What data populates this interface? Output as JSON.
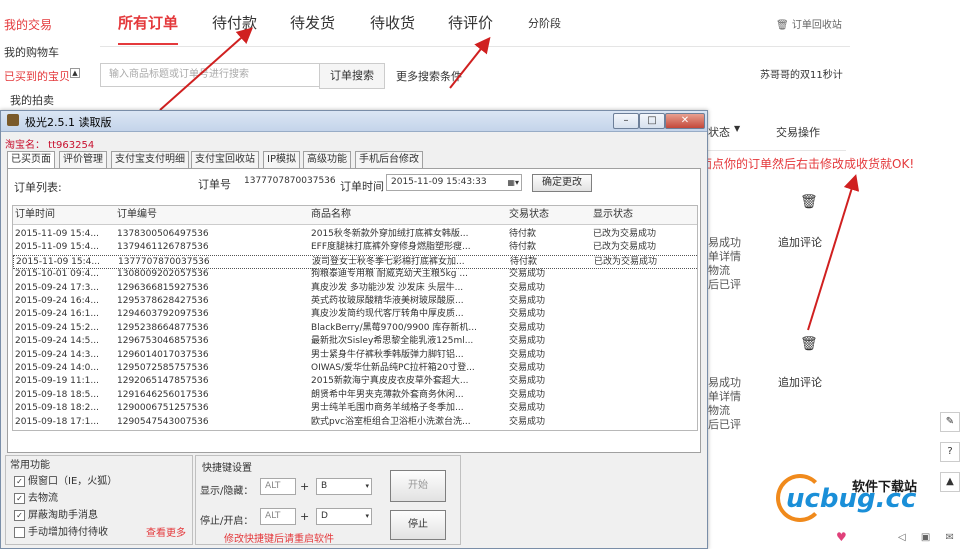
{
  "shop": {
    "left_nav": [
      "我的交易",
      "我的购物车",
      "已买到的宝贝",
      "我的拍卖"
    ],
    "tabs": [
      "所有订单",
      "待付款",
      "待发货",
      "待收货",
      "待评价",
      "分阶段"
    ],
    "recycle": "订单回收站",
    "search_placeholder": "输入商品标题或订单号进行搜索",
    "search_button": "订单搜索",
    "more_search": "更多搜索条件",
    "promo": "苏哥哥的双11秒计",
    "status_header": "状态",
    "op_header": "交易操作",
    "right_a": [
      "易成功",
      "单详情",
      "物流",
      "后已评"
    ],
    "right_b": [
      "易成功",
      "单详情",
      "物流",
      "后已评"
    ],
    "add_review": "追加评论",
    "add_review2": "追加评论"
  },
  "annotation": "只需要从软件里面点你的订单然后右击修改成收货就OK!",
  "watermark": {
    "brand": "ucbug.cc",
    "site": "软件下载站"
  },
  "window": {
    "title": "极光2.5.1 读取版",
    "seller": "淘宝名：  tt963254",
    "tabs": [
      "已买页面",
      "评价管理",
      "支付宝支付明细",
      "支付宝回收站",
      "IP模拟",
      "高级功能",
      "手机后台修改"
    ],
    "order_list_label": "订单列表:",
    "order_no_label": "订单号",
    "order_no_value": "1377707870037536",
    "order_time_label": "订单时间",
    "order_time_value": "2015-11-09 15:43:33",
    "confirm_button": "确定更改",
    "columns": [
      "订单时间",
      "订单编号",
      "商品名称",
      "交易状态",
      "显示状态"
    ],
    "rows": [
      [
        "2015-11-09 15:4...",
        "1378300506497536",
        "2015秋冬新款外穿加绒打底裤女韩版...",
        "待付款",
        "已改为交易成功"
      ],
      [
        "2015-11-09 15:4...",
        "1379461126787536",
        "EFF度腿袜打底裤外穿修身燃脂塑形瘦...",
        "待付款",
        "已改为交易成功"
      ],
      [
        "2015-11-09 15:4...",
        "1377707870037536",
        "波司登女士秋冬季七彩棉打底裤女加...",
        "待付款",
        "已改为交易成功"
      ],
      [
        "2015-10-01 09:4...",
        "1308009202057536",
        "狗粮泰迪专用粮 耐威克幼犬主粮5kg ...",
        "交易成功",
        ""
      ],
      [
        "2015-09-24 17:3...",
        "1296366815927536",
        "真皮沙发 多功能沙发 沙发床 头层牛...",
        "交易成功",
        ""
      ],
      [
        "2015-09-24 16:4...",
        "1295378628427536",
        "英式药妆玻尿酸精华液美树玻尿酸原...",
        "交易成功",
        ""
      ],
      [
        "2015-09-24 16:1...",
        "1294603792097536",
        "真皮沙发简约现代客厅转角中厚皮质...",
        "交易成功",
        ""
      ],
      [
        "2015-09-24 15:2...",
        "1295238664877536",
        "BlackBerry/黑莓9700/9900 库存新机...",
        "交易成功",
        ""
      ],
      [
        "2015-09-24 14:5...",
        "1296753046857536",
        "最新批次Sisley希思黎全能乳液125ml...",
        "交易成功",
        ""
      ],
      [
        "2015-09-24 14:3...",
        "1296014017037536",
        "男士紧身牛仔裤秋季韩版弹力脚钉铝...",
        "交易成功",
        ""
      ],
      [
        "2015-09-24 14:0...",
        "1295072585757536",
        "OIWAS/爱华仕新品纯PC拉杆箱20寸登...",
        "交易成功",
        ""
      ],
      [
        "2015-09-19 11:1...",
        "1292065147857536",
        "2015新款海宁真皮皮衣皮草外套超大...",
        "交易成功",
        ""
      ],
      [
        "2015-09-18 18:5...",
        "1291646256017536",
        "朗贤希中年男夹克薄款外套商务休闲...",
        "交易成功",
        ""
      ],
      [
        "2015-09-18 18:2...",
        "1290006751257536",
        "男士纯羊毛围巾商务羊绒格子冬季加...",
        "交易成功",
        ""
      ],
      [
        "2015-09-18 17:1...",
        "1290547543007536",
        "欧式pvc浴室柜组合卫浴柜小洗漱台洗...",
        "交易成功",
        ""
      ]
    ],
    "common_title": "常用功能",
    "options": [
      {
        "label": "假窗口（IE，火狐）",
        "checked": true
      },
      {
        "label": "去物流",
        "checked": true
      },
      {
        "label": "屏蔽淘助手消息",
        "checked": true
      },
      {
        "label": "手动增加待付待收",
        "checked": false
      }
    ],
    "view_more": "查看更多",
    "shortcut_title": "快捷键设置",
    "show_hide_label": "显示/隐藏：",
    "stop_start_label": "停止/开启：",
    "alt": "ALT",
    "alt2": "ALT",
    "plus": "+",
    "plus2": "+",
    "key1": "B",
    "key2": "D",
    "start_button": "开始",
    "stop_button": "停止",
    "restart_note": "修改快捷键后请重启软件"
  },
  "colors": {
    "accent": "#e4393c",
    "window_bg": "#f0f0f0"
  }
}
